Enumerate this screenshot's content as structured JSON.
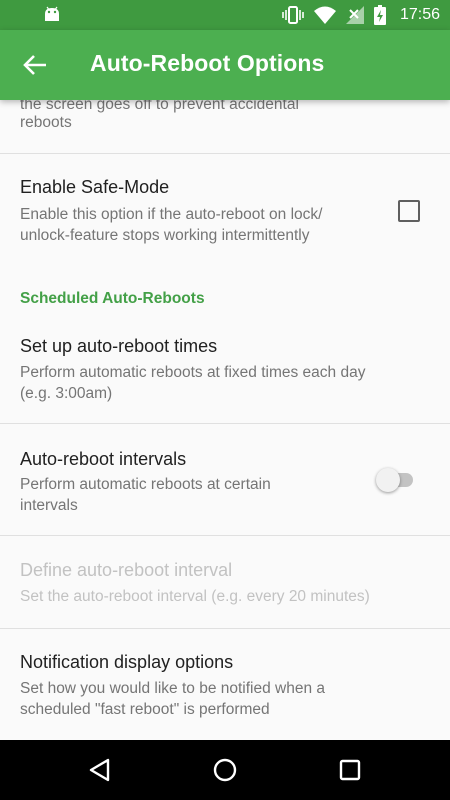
{
  "status_bar": {
    "time": "17:56",
    "icons": [
      "android-icon",
      "vibrate-icon",
      "wifi-icon",
      "signal-no-sim-icon",
      "battery-charging-icon"
    ]
  },
  "app_bar": {
    "title": "Auto-Reboot Options",
    "back_icon": "arrow-back-icon"
  },
  "preferences": {
    "partial_top": {
      "summary_line1": "the screen goes off to prevent accidental",
      "summary_line2": "reboots"
    },
    "safe_mode": {
      "title": "Enable Safe-Mode",
      "summary_line1": "Enable this option if the auto-reboot on lock/",
      "summary_line2": "unlock-feature stops working intermittently",
      "checked": false
    },
    "category": "Scheduled Auto-Reboots",
    "reboot_times": {
      "title": "Set up auto-reboot times",
      "summary_line1": "Perform automatic reboots at fixed times each day",
      "summary_line2": "(e.g. 3:00am)"
    },
    "reboot_intervals": {
      "title": "Auto-reboot intervals",
      "summary_line1": "Perform automatic reboots at certain",
      "summary_line2": "intervals",
      "enabled": false
    },
    "define_interval": {
      "title": "Define auto-reboot interval",
      "summary": "Set the auto-reboot interval (e.g. every 20 minutes)",
      "disabled": true
    },
    "notification_options": {
      "title": "Notification display options",
      "summary_line1": "Set how you would like to be notified when a",
      "summary_line2": "scheduled \"fast reboot\" is performed"
    }
  },
  "nav_bar": {
    "icons": [
      "back-triangle-icon",
      "home-circle-icon",
      "recents-square-icon"
    ]
  },
  "colors": {
    "status_bar": "#3f9a40",
    "app_bar": "#4caf50",
    "accent": "#43a047",
    "background": "#fafafa"
  }
}
